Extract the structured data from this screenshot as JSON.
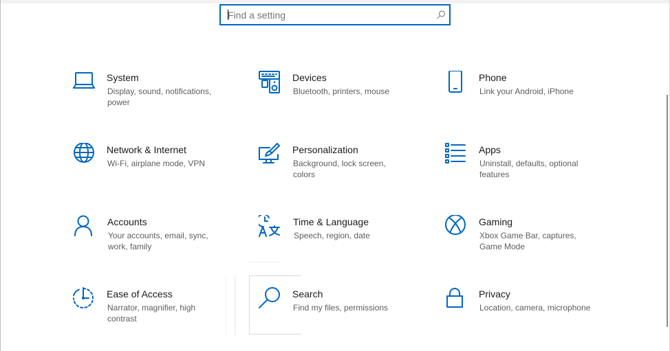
{
  "search": {
    "placeholder": "Find a setting",
    "value": ""
  },
  "accent_color": "#0067c0",
  "tiles": [
    {
      "title": "System",
      "desc": "Display, sound, notifications, power",
      "icon": "laptop-icon"
    },
    {
      "title": "Devices",
      "desc": "Bluetooth, printers, mouse",
      "icon": "devices-icon"
    },
    {
      "title": "Phone",
      "desc": "Link your Android, iPhone",
      "icon": "phone-icon"
    },
    {
      "title": "Network & Internet",
      "desc": "Wi-Fi, airplane mode, VPN",
      "icon": "globe-icon"
    },
    {
      "title": "Personalization",
      "desc": "Background, lock screen, colors",
      "icon": "paint-monitor-icon"
    },
    {
      "title": "Apps",
      "desc": "Uninstall, defaults, optional features",
      "icon": "apps-list-icon"
    },
    {
      "title": "Accounts",
      "desc": "Your accounts, email, sync, work, family",
      "icon": "person-icon"
    },
    {
      "title": "Time & Language",
      "desc": "Speech, region, date",
      "icon": "time-language-icon"
    },
    {
      "title": "Gaming",
      "desc": "Xbox Game Bar, captures, Game Mode",
      "icon": "xbox-icon"
    },
    {
      "title": "Ease of Access",
      "desc": "Narrator, magnifier, high contrast",
      "icon": "ease-of-access-icon"
    },
    {
      "title": "Search",
      "desc": "Find my files, permissions",
      "icon": "search-icon"
    },
    {
      "title": "Privacy",
      "desc": "Location, camera, microphone",
      "icon": "lock-icon"
    }
  ]
}
